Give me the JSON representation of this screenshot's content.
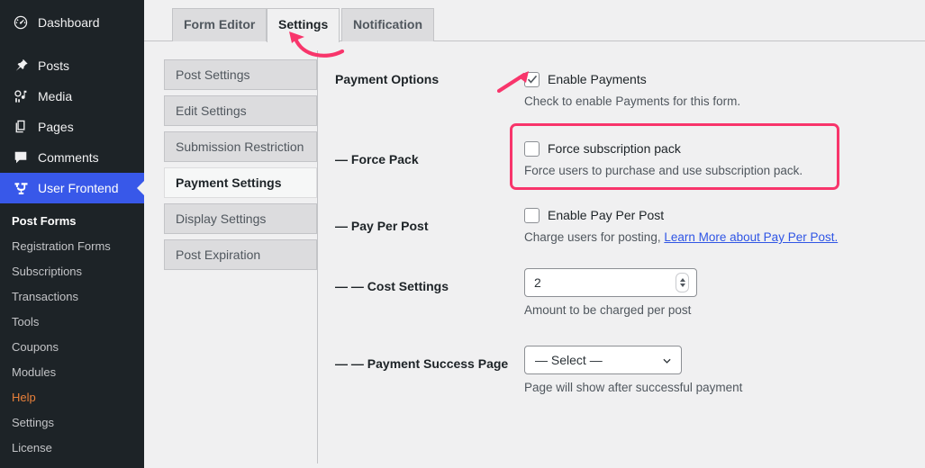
{
  "sidebar": {
    "menu": [
      {
        "label": "Dashboard",
        "icon": "dashboard-icon",
        "current": false
      },
      {
        "label": "Posts",
        "icon": "pin-icon",
        "current": false
      },
      {
        "label": "Media",
        "icon": "media-icon",
        "current": false
      },
      {
        "label": "Pages",
        "icon": "pages-icon",
        "current": false
      },
      {
        "label": "Comments",
        "icon": "comments-icon",
        "current": false
      },
      {
        "label": "User Frontend",
        "icon": "user-frontend-icon",
        "current": true
      }
    ],
    "submenu": [
      {
        "label": "Post Forms",
        "current": true
      },
      {
        "label": "Registration Forms",
        "current": false
      },
      {
        "label": "Subscriptions",
        "current": false
      },
      {
        "label": "Transactions",
        "current": false
      },
      {
        "label": "Tools",
        "current": false
      },
      {
        "label": "Coupons",
        "current": false
      },
      {
        "label": "Modules",
        "current": false
      },
      {
        "label": "Help",
        "current": false
      },
      {
        "label": "Settings",
        "current": false
      },
      {
        "label": "License",
        "current": false
      }
    ],
    "active_color": "#3858e9",
    "help_color": "#e9803a"
  },
  "tabs": [
    {
      "label": "Form Editor",
      "active": false
    },
    {
      "label": "Settings",
      "active": true
    },
    {
      "label": "Notification",
      "active": false
    }
  ],
  "settings_nav": [
    {
      "label": "Post Settings",
      "active": false
    },
    {
      "label": "Edit Settings",
      "active": false
    },
    {
      "label": "Submission Restriction",
      "active": false
    },
    {
      "label": "Payment Settings",
      "active": true
    },
    {
      "label": "Display Settings",
      "active": false
    },
    {
      "label": "Post Expiration",
      "active": false
    }
  ],
  "form": {
    "payment_options": {
      "label": "Payment Options",
      "checkbox_label": "Enable Payments",
      "checked": true,
      "description": "Check to enable Payments for this form."
    },
    "force_pack": {
      "label": "— Force Pack",
      "checkbox_label": "Force subscription pack",
      "checked": false,
      "description": "Force users to purchase and use subscription pack."
    },
    "pay_per_post": {
      "label": "— Pay Per Post",
      "checkbox_label": "Enable Pay Per Post",
      "checked": false,
      "description_prefix": "Charge users for posting,",
      "link_text": "Learn More about Pay Per Post.",
      "link_color": "#2f55e5"
    },
    "cost_settings": {
      "label": "— — Cost Settings",
      "value": "2",
      "description": "Amount to be charged per post"
    },
    "payment_success_page": {
      "label": "— — Payment Success Page",
      "selected": "— Select —",
      "description": "Page will show after successful payment"
    }
  },
  "annotations": {
    "color": "#f8356b",
    "tab_arrow": "curved-arrow-icon",
    "checkbox_arrow": "straight-arrow-icon",
    "highlight": "highlight-rectangle"
  }
}
